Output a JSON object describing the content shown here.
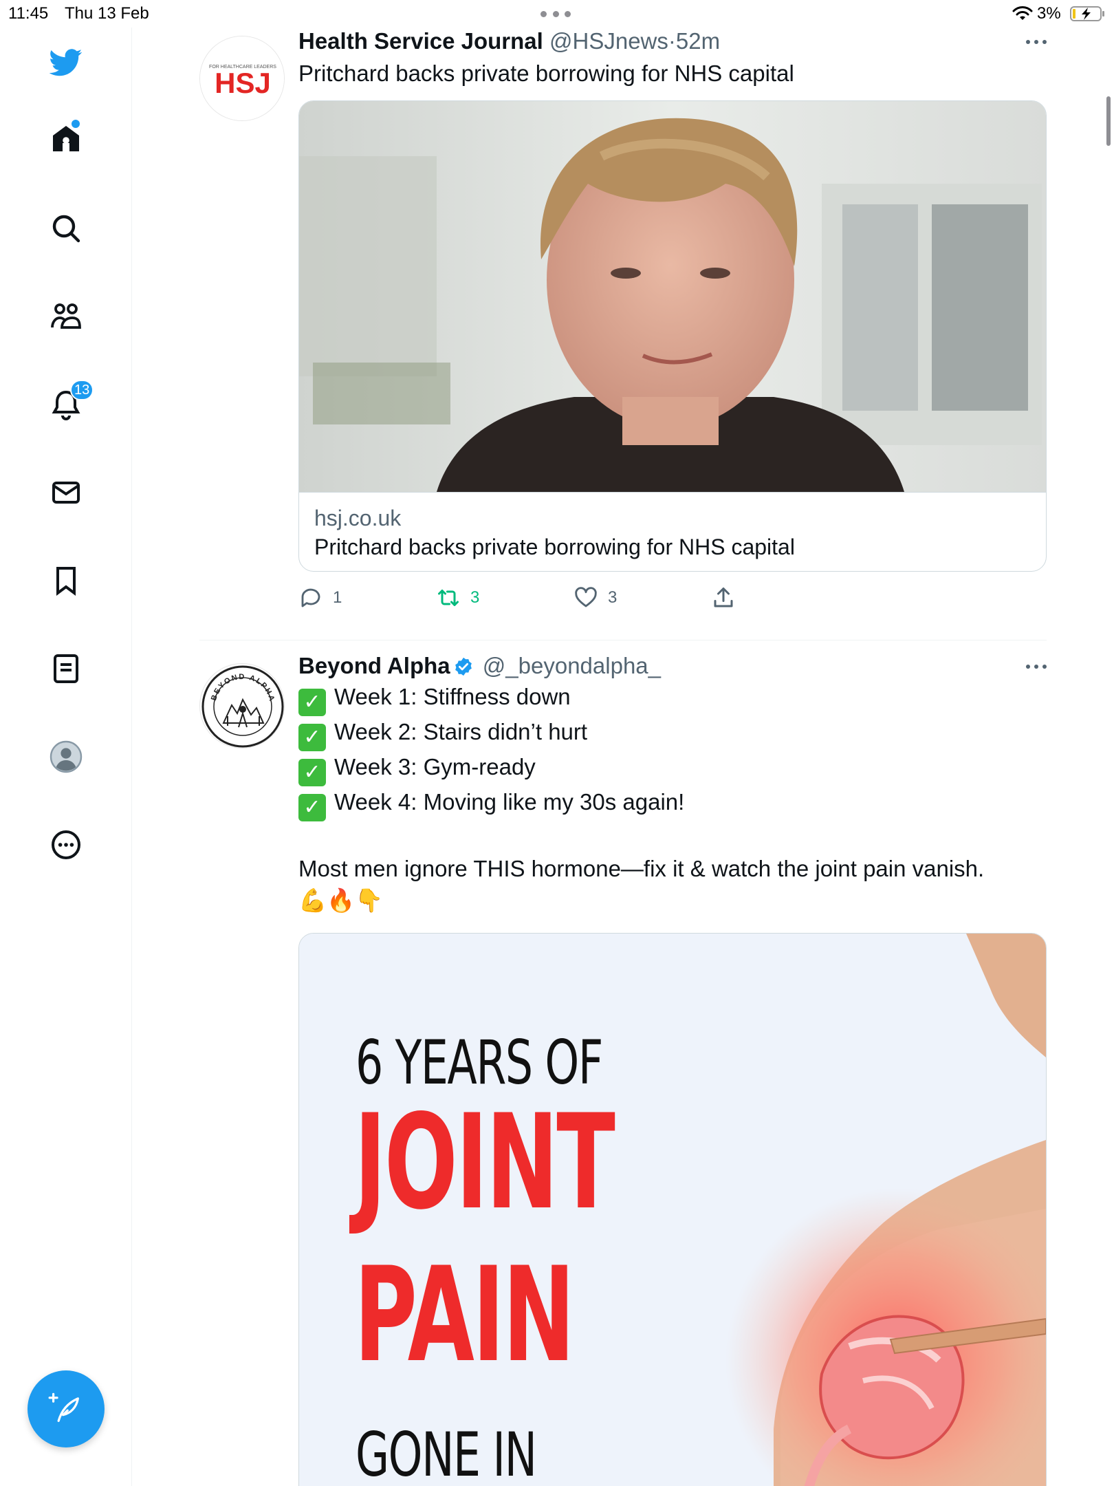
{
  "status_bar": {
    "time": "11:45",
    "date": "Thu 13 Feb",
    "battery": "3%"
  },
  "sidebar": {
    "notification_count": "13",
    "items": [
      {
        "name": "home"
      },
      {
        "name": "explore"
      },
      {
        "name": "communities"
      },
      {
        "name": "notifications"
      },
      {
        "name": "messages"
      },
      {
        "name": "bookmarks"
      },
      {
        "name": "lists"
      },
      {
        "name": "profile"
      },
      {
        "name": "more"
      }
    ]
  },
  "tweets": [
    {
      "name": "Health Service Journal",
      "handle": "@HSJnews",
      "separator": "·",
      "time": "52m",
      "text": "Pritchard backs private borrowing for NHS capital",
      "avatar": {
        "tagline": "FOR HEALTHCARE LEADERS",
        "logo": "HSJ"
      },
      "card": {
        "domain": "hsj.co.uk",
        "title": "Pritchard backs private borrowing for NHS capital"
      },
      "replies": "1",
      "retweets": "3",
      "likes": "3"
    },
    {
      "name": "Beyond Alpha",
      "handle": "@_beyondalpha_",
      "verified": true,
      "avatar": {
        "ring_text": "BEYOND ALPHA"
      },
      "lines": [
        "Week 1: Stiffness down",
        "Week 2: Stairs didn’t hurt",
        "Week 3: Gym-ready",
        "Week 4: Moving like my 30s again!"
      ],
      "text": "Most men ignore THIS hormone—fix it & watch the joint pain vanish.",
      "emojis": "💪🔥👇",
      "ad": {
        "line1": "6 YEARS OF",
        "line2": "JOINT",
        "line3": "PAIN",
        "line4": "GONE IN"
      }
    }
  ],
  "colors": {
    "accent": "#1d9bf0",
    "retweet": "#00ba7c",
    "muted": "#536471",
    "ad_red": "#ee2b2b"
  }
}
